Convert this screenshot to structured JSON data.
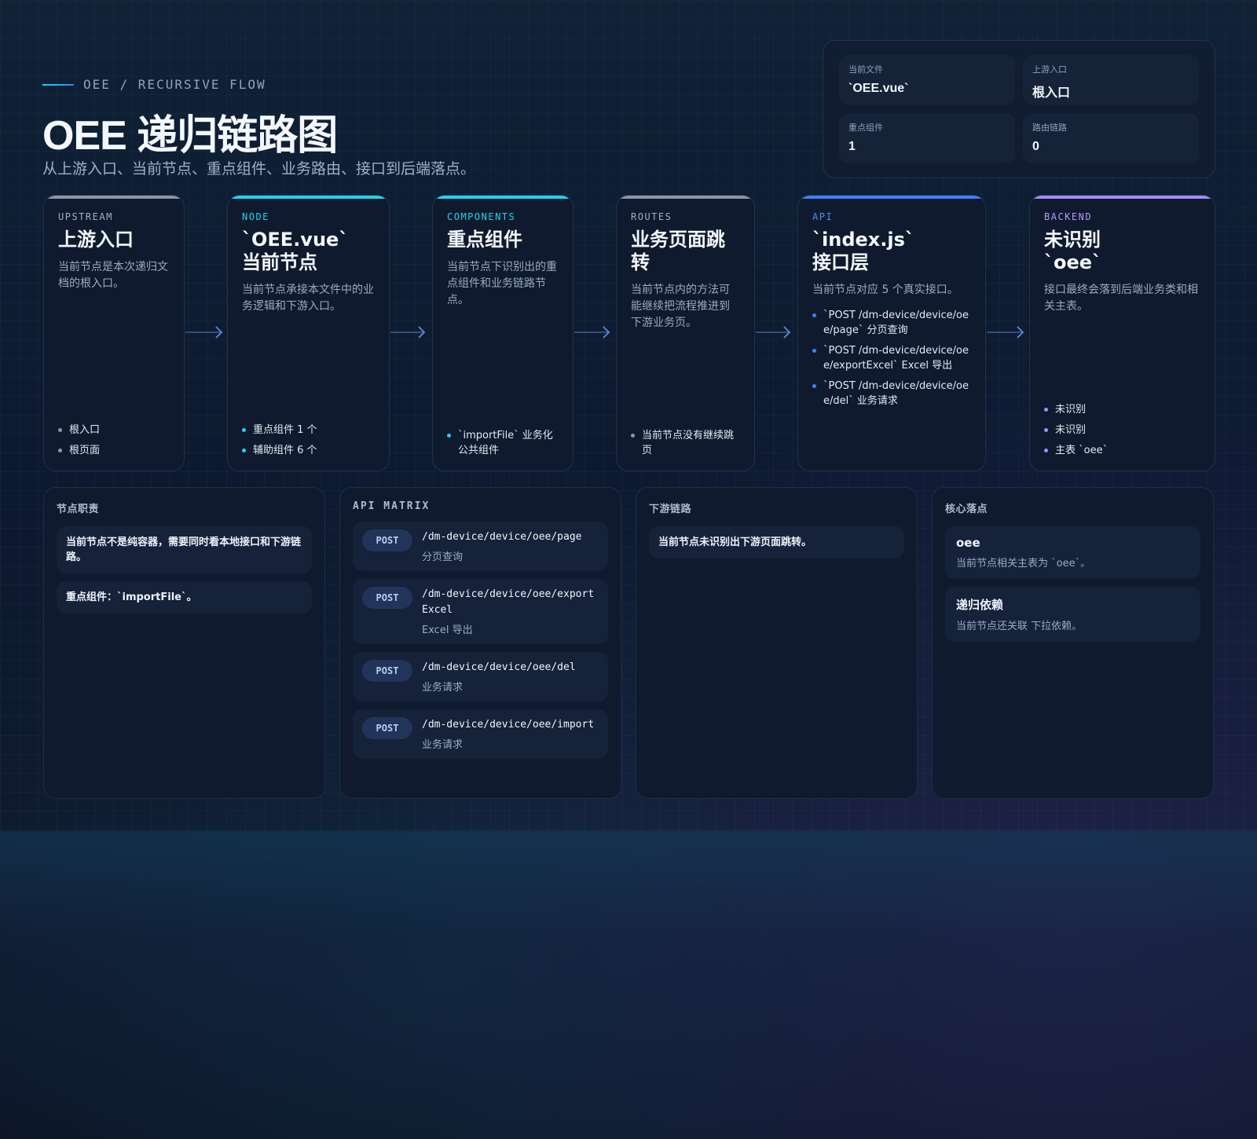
{
  "header": {
    "eyebrow": "OEE / RECURSIVE FLOW",
    "title": "OEE 递归链路图",
    "subtitle": "从上游入口、当前节点、重点组件、业务路由、接口到后端落点。"
  },
  "stats": [
    {
      "label": "当前文件",
      "value": "`OEE.vue`"
    },
    {
      "label": "上游入口",
      "value": "根入口"
    },
    {
      "label": "重点组件",
      "value": "1"
    },
    {
      "label": "路由链路",
      "value": "0"
    }
  ],
  "cards": {
    "upstream": {
      "tag": "UPSTREAM",
      "title": "上游入口",
      "desc": "当前节点是本次递归文档的根入口。",
      "items": [
        "根入口",
        "根页面"
      ]
    },
    "node": {
      "tag": "NODE",
      "title": "`OEE.vue` 当前节点",
      "desc": "当前节点承接本文件中的业务逻辑和下游入口。",
      "items": [
        "重点组件 1 个",
        "辅助组件 6 个"
      ]
    },
    "components": {
      "tag": "COMPONENTS",
      "title": "重点组件",
      "desc": "当前节点下识别出的重点组件和业务链路节点。",
      "items": [
        "`importFile` 业务化公共组件"
      ]
    },
    "routes": {
      "tag": "ROUTES",
      "title": "业务页面跳转",
      "desc": "当前节点内的方法可能继续把流程推进到下游业务页。",
      "items": [
        "当前节点没有继续跳页"
      ]
    },
    "api": {
      "tag": "API",
      "title": "`index.js` 接口层",
      "desc": "当前节点对应 5 个真实接口。",
      "items": [
        "`POST /dm-device/device/oee/page` 分页查询",
        "`POST /dm-device/device/oee/exportExcel` Excel 导出",
        "`POST /dm-device/device/oee/del` 业务请求"
      ]
    },
    "backend": {
      "tag": "BACKEND",
      "title": "未识别 `oee`",
      "desc": "接口最终会落到后端业务类和相关主表。",
      "items": [
        "未识别",
        "未识别",
        "主表 `oee`"
      ]
    }
  },
  "panels": {
    "duty": {
      "title": "节点职责",
      "notes": [
        "当前节点不是纯容器，需要同时看本地接口和下游链路。",
        "重点组件：`importFile`。"
      ]
    },
    "api_matrix": {
      "title": "API MATRIX",
      "rows": [
        {
          "method": "POST",
          "path": "/dm-device/device/oee/page",
          "desc": "分页查询"
        },
        {
          "method": "POST",
          "path": "/dm-device/device/oee/exportExcel",
          "desc": "Excel 导出"
        },
        {
          "method": "POST",
          "path": "/dm-device/device/oee/del",
          "desc": "业务请求"
        },
        {
          "method": "POST",
          "path": "/dm-device/device/oee/import",
          "desc": "业务请求"
        }
      ]
    },
    "downstream": {
      "title": "下游链路",
      "notes": [
        "当前节点未识别出下游页面跳转。"
      ]
    },
    "core": {
      "title": "核心落点",
      "items": [
        {
          "name": "oee",
          "desc": "当前节点相关主表为 `oee`。"
        },
        {
          "name": "递归依赖",
          "desc": "当前节点还关联 下拉依赖。"
        }
      ]
    }
  },
  "colors": {
    "accent_cyan": "#22d3ee",
    "accent_blue": "#3b82f6",
    "accent_purple": "#a78bfa",
    "accent_gray": "#8a96a8"
  }
}
